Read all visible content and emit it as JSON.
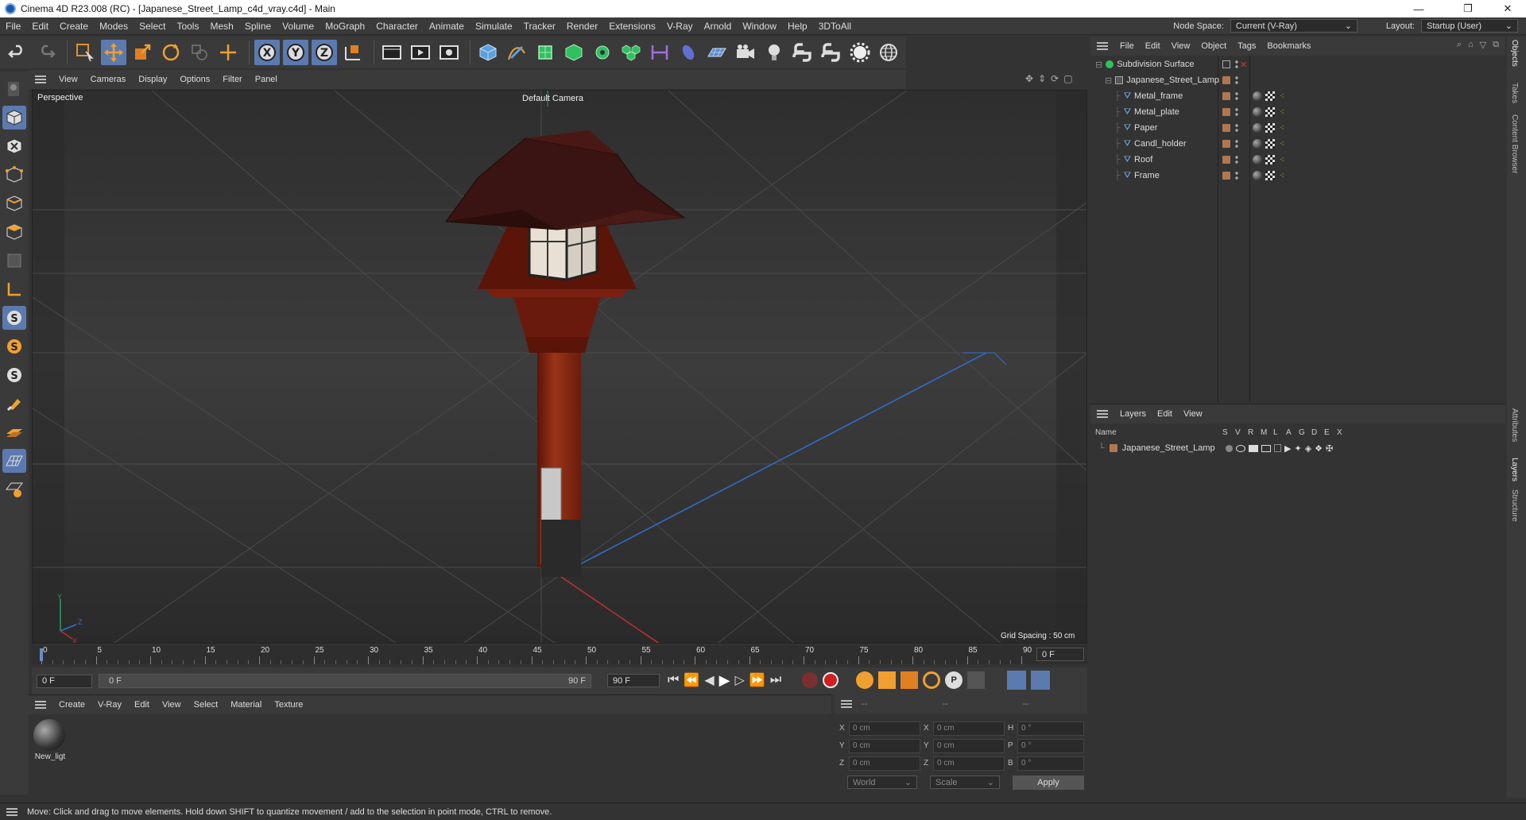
{
  "window": {
    "title": "Cinema 4D R23.008 (RC) - [Japanese_Street_Lamp_c4d_vray.c4d] - Main",
    "minimize": "—",
    "maximize": "❐",
    "close": "✕"
  },
  "menubar": {
    "items": [
      "File",
      "Edit",
      "Create",
      "Modes",
      "Select",
      "Tools",
      "Mesh",
      "Spline",
      "Volume",
      "MoGraph",
      "Character",
      "Animate",
      "Simulate",
      "Tracker",
      "Render",
      "Extensions",
      "V-Ray",
      "Arnold",
      "Window",
      "Help",
      "3DToAll"
    ],
    "node_space_label": "Node Space:",
    "node_space_value": "Current (V-Ray)",
    "layout_label": "Layout:",
    "layout_value": "Startup (User)"
  },
  "viewport": {
    "menu": [
      "View",
      "Cameras",
      "Display",
      "Options",
      "Filter",
      "Panel"
    ],
    "view_name": "Perspective",
    "camera": "Default Camera",
    "grid_spacing": "Grid Spacing : 50 cm",
    "axis_x": "X",
    "axis_y": "Y",
    "axis_z": "Z"
  },
  "timeline": {
    "ticks": [
      "0",
      "5",
      "10",
      "15",
      "20",
      "25",
      "30",
      "35",
      "40",
      "45",
      "50",
      "55",
      "60",
      "65",
      "70",
      "75",
      "80",
      "85",
      "90"
    ],
    "current_frame_display": "0 F",
    "start_frame": "0 F",
    "range_start": "0 F",
    "range_end": "90 F",
    "end_frame": "90 F"
  },
  "materials": {
    "menu": [
      "Create",
      "V-Ray",
      "Edit",
      "View",
      "Select",
      "Material",
      "Texture"
    ],
    "items": [
      {
        "name": "New_ligt"
      }
    ]
  },
  "coordinates": {
    "headers": [
      "--",
      "--",
      "--"
    ],
    "rows": [
      {
        "a_label": "X",
        "a_val": "0 cm",
        "b_label": "X",
        "b_val": "0 cm",
        "c_label": "H",
        "c_val": "0 °"
      },
      {
        "a_label": "Y",
        "a_val": "0 cm",
        "b_label": "Y",
        "b_val": "0 cm",
        "c_label": "P",
        "c_val": "0 °"
      },
      {
        "a_label": "Z",
        "a_val": "0 cm",
        "b_label": "Z",
        "b_val": "0 cm",
        "c_label": "B",
        "c_val": "0 °"
      }
    ],
    "world": "World",
    "scale": "Scale",
    "apply": "Apply"
  },
  "objects": {
    "menu": [
      "File",
      "Edit",
      "View",
      "Object",
      "Tags",
      "Bookmarks"
    ],
    "items": [
      {
        "name": "Subdivision Surface",
        "level": 0
      },
      {
        "name": "Japanese_Street_Lamp",
        "level": 1
      },
      {
        "name": "Metal_frame",
        "level": 2
      },
      {
        "name": "Metal_plate",
        "level": 2
      },
      {
        "name": "Paper",
        "level": 2
      },
      {
        "name": "Candl_holder",
        "level": 2
      },
      {
        "name": "Roof",
        "level": 2
      },
      {
        "name": "Frame",
        "level": 2
      }
    ]
  },
  "layers": {
    "menu": [
      "Layers",
      "Edit",
      "View"
    ],
    "columns": [
      "Name",
      "S",
      "V",
      "R",
      "M",
      "L",
      "A",
      "G",
      "D",
      "E",
      "X"
    ],
    "items": [
      {
        "name": "Japanese_Street_Lamp"
      }
    ]
  },
  "side_tabs": [
    "Objects",
    "Takes",
    "Content Browser",
    "Attributes",
    "Layers",
    "Structure"
  ],
  "status": "Move: Click and drag to move elements. Hold down SHIFT to quantize movement / add to the selection in point mode, CTRL to remove.",
  "colors": {
    "accent": "#5b7ab0",
    "wood": "#8a2a14",
    "roof": "#3a1412",
    "axis_x": "#c03030",
    "axis_z": "#3070d0"
  }
}
